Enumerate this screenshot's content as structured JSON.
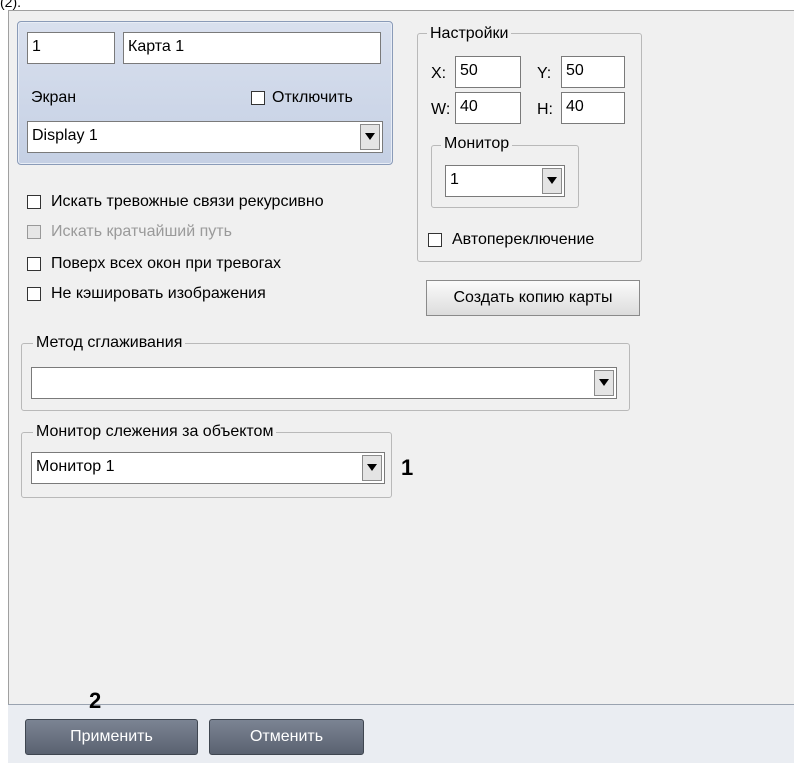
{
  "top_fragment": "(2).",
  "map": {
    "id": "1",
    "name": "Карта 1"
  },
  "screen": {
    "label": "Экран",
    "disable_label": "Отключить",
    "display_value": "Display 1"
  },
  "settings": {
    "title": "Настройки",
    "x_label": "X:",
    "x_value": "50",
    "y_label": "Y:",
    "y_value": "50",
    "w_label": "W:",
    "w_value": "40",
    "h_label": "H:",
    "h_value": "40",
    "monitor_title": "Монитор",
    "monitor_value": "1",
    "autoswitch_label": "Автопереключение"
  },
  "options": [
    {
      "label": "Искать тревожные связи рекурсивно",
      "checked": false,
      "disabled": false
    },
    {
      "label": "Искать кратчайший путь",
      "checked": false,
      "disabled": true
    },
    {
      "label": "Поверх всех окон при тревогах",
      "checked": false,
      "disabled": false
    },
    {
      "label": "Не кэшировать изображения",
      "checked": false,
      "disabled": false
    }
  ],
  "copy_map_button": "Создать копию карты",
  "smoothing": {
    "title": "Метод сглаживания",
    "value": ""
  },
  "tracking": {
    "title": "Монитор слежения за объектом",
    "value": "Монитор 1"
  },
  "markers": {
    "one": "1",
    "two": "2"
  },
  "footer": {
    "apply": "Применить",
    "cancel": "Отменить"
  },
  "icons": [
    "chevron-down-icon",
    "checkbox-icon"
  ]
}
